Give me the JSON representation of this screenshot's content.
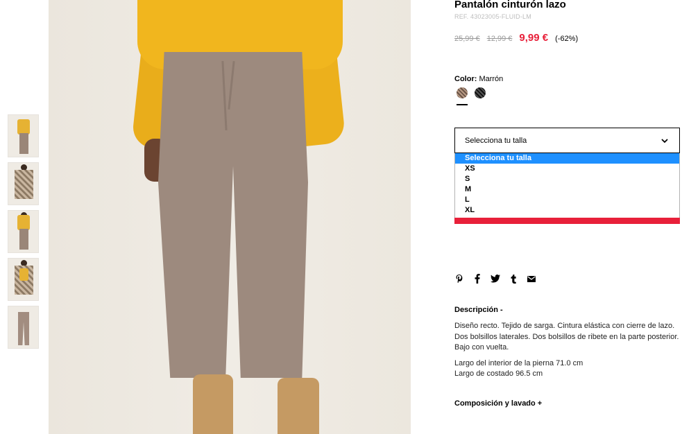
{
  "product": {
    "title": "Pantalón cinturón lazo",
    "ref": "REF. 43023005-FLUID-LM",
    "prices": {
      "original": "25,99 €",
      "previous": "12,99 €",
      "current": "9,99 €",
      "discount": "(-62%)"
    },
    "color": {
      "label": "Color:",
      "value": "Marrón",
      "swatches": [
        "brown-check-swatch",
        "black-check-swatch"
      ],
      "selected_index": 0
    },
    "size_select": {
      "selected": "Selecciona tu talla",
      "options": [
        "Selecciona tu talla",
        "XS",
        "S",
        "M",
        "L",
        "XL"
      ]
    },
    "share_icons": [
      "pinterest-icon",
      "facebook-icon",
      "twitter-icon",
      "tumblr-icon",
      "email-icon"
    ],
    "description": {
      "heading": "Descripción -",
      "body": "Diseño recto. Tejido de sarga. Cintura elástica con cierre de lazo. Dos bolsillos laterales. Dos bolsillos de ribete en la parte posterior. Bajo con vuelta.",
      "inner_leg": "Largo del interior de la pierna 71.0 cm",
      "side_length": "Largo de costado 96.5 cm"
    },
    "composition_heading": "Composición y lavado +"
  },
  "colors": {
    "sale_red": "#e8203a",
    "dropdown_highlight": "#1e90ff"
  },
  "gallery": {
    "thumbnails": [
      "thumb-front-model",
      "thumb-coat-model",
      "thumb-full-body",
      "thumb-portrait-coat",
      "thumb-flat-product"
    ]
  }
}
